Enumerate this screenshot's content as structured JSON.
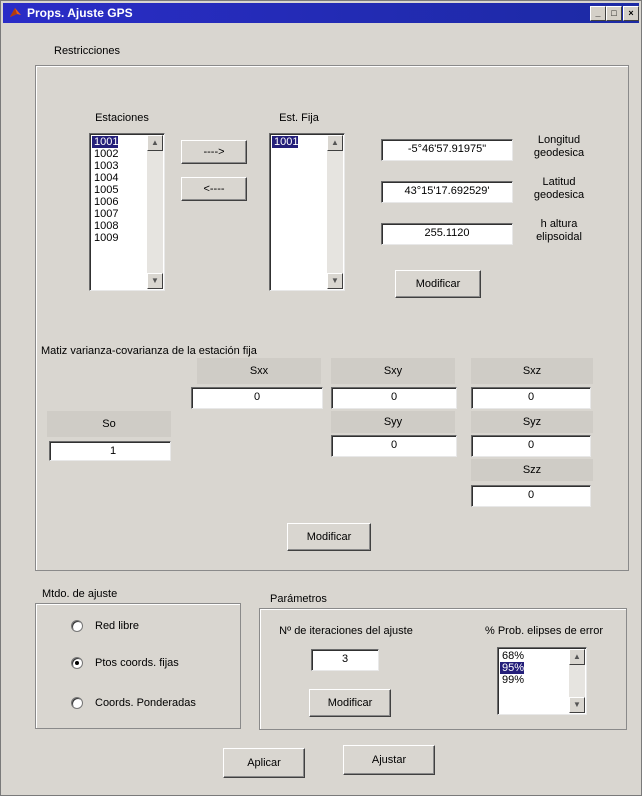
{
  "window": {
    "title": "Props. Ajuste GPS"
  },
  "restricciones": {
    "label": "Restricciones",
    "estaciones_label": "Estaciones",
    "estaciones": [
      "1001",
      "1002",
      "1003",
      "1004",
      "1005",
      "1006",
      "1007",
      "1008",
      "1009"
    ],
    "estaciones_selected": "1001",
    "btn_right": "---->",
    "btn_left": "<----",
    "est_fija_label": "Est. Fija",
    "est_fija": [
      "1001"
    ],
    "longitud_value": "-5°46'57.91975\"",
    "longitud_label": "Longitud geodesica",
    "latitud_value": "43°15'17.692529'",
    "latitud_label": "Latitud geodesica",
    "altura_value": "255.1120",
    "altura_label": "h altura elipsoidal",
    "modificar_coords": "Modificar",
    "matriz_label": "Matiz varianza-covarianza de la estación fija",
    "sxx_label": "Sxx",
    "sxx": "0",
    "sxy_label": "Sxy",
    "sxy": "0",
    "sxz_label": "Sxz",
    "sxz": "0",
    "syy_label": "Syy",
    "syy": "0",
    "syz_label": "Syz",
    "syz": "0",
    "szz_label": "Szz",
    "szz": "0",
    "so_label": "So",
    "so": "1",
    "modificar_matriz": "Modificar"
  },
  "metodo": {
    "label": "Mtdo. de ajuste",
    "options": [
      "Red libre",
      "Ptos coords. fijas",
      "Coords. Ponderadas"
    ],
    "selected": "Ptos coords. fijas"
  },
  "parametros": {
    "label": "Parámetros",
    "iter_label": "Nº de iteraciones del ajuste",
    "iter_value": "3",
    "prob_label": "% Prob. elipses de error",
    "prob_options": [
      "68%",
      "95%",
      "99%"
    ],
    "prob_selected": "95%",
    "modificar": "Modificar"
  },
  "footer": {
    "aplicar": "Aplicar",
    "ajustar": "Ajustar"
  }
}
